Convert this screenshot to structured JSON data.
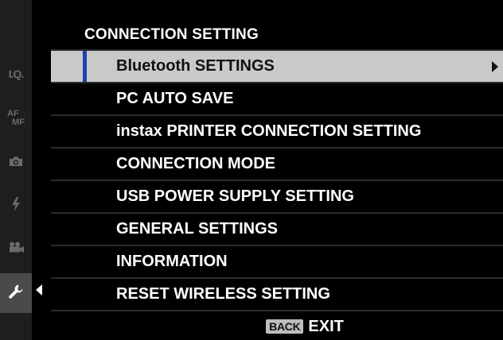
{
  "sidebar": {
    "items": [
      {
        "icon": "image-quality-icon",
        "label": "I.Q."
      },
      {
        "icon": "autofocus-icon",
        "label_top": "AF",
        "label_bottom": "MF"
      },
      {
        "icon": "camera-icon"
      },
      {
        "icon": "flash-icon"
      },
      {
        "icon": "movie-icon"
      },
      {
        "icon": "wrench-icon",
        "active": true
      }
    ]
  },
  "menu": {
    "title": "CONNECTION SETTING",
    "items": [
      {
        "label": "Bluetooth SETTINGS",
        "selected": true,
        "has_submenu": true
      },
      {
        "label": "PC AUTO SAVE"
      },
      {
        "label": "instax PRINTER CONNECTION SETTING"
      },
      {
        "label": "CONNECTION MODE"
      },
      {
        "label": "USB POWER SUPPLY SETTING"
      },
      {
        "label": "GENERAL SETTINGS"
      },
      {
        "label": "INFORMATION"
      },
      {
        "label": "RESET WIRELESS SETTING"
      }
    ]
  },
  "footer": {
    "back_badge": "BACK",
    "exit_label": "EXIT"
  },
  "colors": {
    "background": "#000000",
    "selected_row": "#c9c9c9",
    "selection_marker": "#1f3fb4",
    "rail_active": "#4a4a4a"
  }
}
